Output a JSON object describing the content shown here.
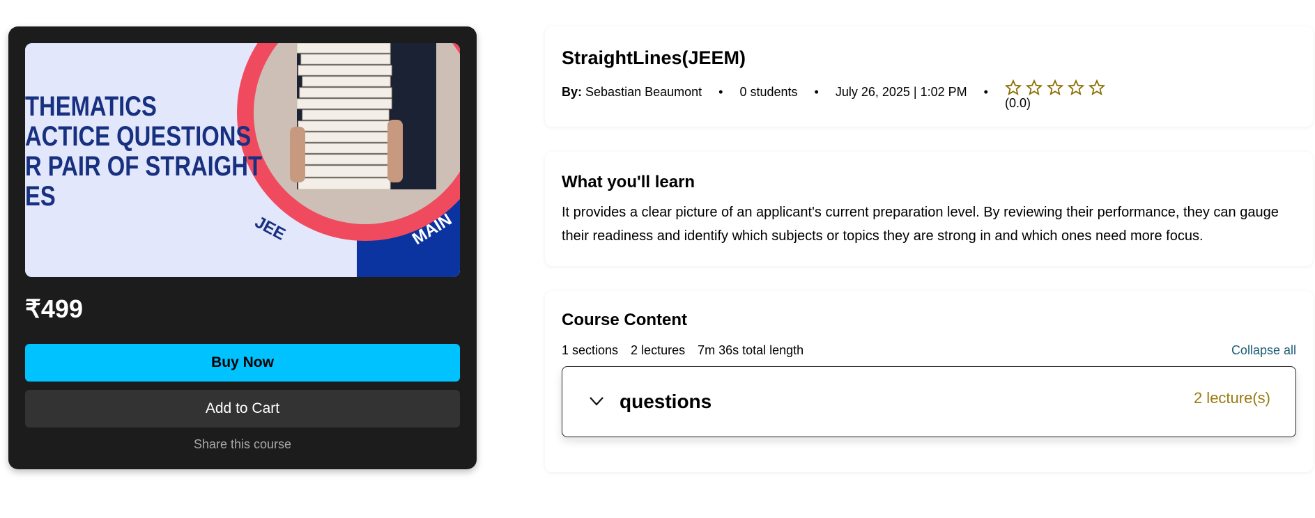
{
  "thumbnail": {
    "lines": [
      "THEMATICS",
      "ACTICE QUESTIONS",
      "R PAIR OF STRAIGHT",
      "ES"
    ],
    "badge_left": "JEE",
    "badge_right": "MAIN"
  },
  "purchase": {
    "price": "₹499",
    "buy_label": "Buy Now",
    "cart_label": "Add to Cart",
    "share_label": "Share this course"
  },
  "course": {
    "title": "StraightLines(JEEM)",
    "by_label": "By:",
    "author": "Sebastian Beaumont",
    "students": "0 students",
    "date": "July 26, 2025 | 1:02 PM",
    "rating": "(0.0)",
    "star_count": 5
  },
  "learn": {
    "heading": "What you'll learn",
    "text": "It provides a clear picture of an applicant's current preparation level. By reviewing their performance, they can gauge their readiness and identify which subjects or topics they are strong in and which ones need more focus."
  },
  "content": {
    "heading": "Course Content",
    "sections": "1 sections",
    "lectures": "2 lectures",
    "length": "7m 36s total length",
    "collapse_label": "Collapse all",
    "section_title": "questions",
    "section_count": "2 lecture(s)"
  },
  "colors": {
    "buy": "#00c2ff",
    "card": "#1c1c1c",
    "star": "#8a6d00",
    "collapse": "#1a5c73",
    "lecture_count": "#9a7a10"
  }
}
